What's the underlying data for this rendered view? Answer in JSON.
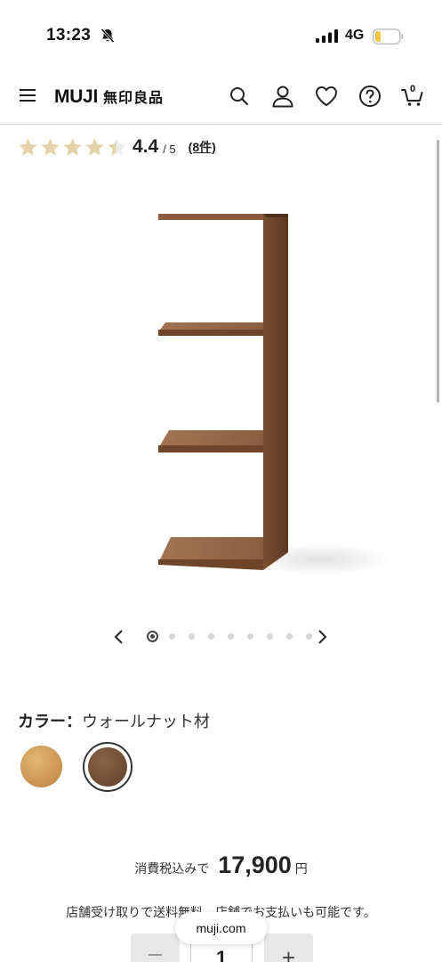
{
  "status_bar": {
    "time": "13:23",
    "network": "4G",
    "icons": [
      "bell-slash-icon",
      "cellular-signal-icon",
      "battery-low-icon"
    ],
    "battery_color": "#f5c542"
  },
  "header": {
    "logo_text": "MUJI",
    "logo_jp": "無印良品",
    "cart_count": "0",
    "icons": [
      "menu-icon",
      "search-icon",
      "user-icon",
      "heart-icon",
      "help-icon",
      "cart-icon"
    ]
  },
  "rating": {
    "score": "4.4",
    "max": "/ 5",
    "count": "(8件)",
    "stars_value": 4.4,
    "star_color": "#e2d3a8"
  },
  "carousel": {
    "total": 9,
    "active_index": 0
  },
  "color": {
    "label": "カラー：",
    "selected": "ウォールナット材",
    "swatches": [
      {
        "name": "oak",
        "color": "#d7a461",
        "selected": false
      },
      {
        "name": "walnut",
        "color": "#6f4c35",
        "selected": true
      }
    ]
  },
  "price": {
    "prefix": "消費税込みで",
    "value": "17,900",
    "unit": "円"
  },
  "shipping_note": "店舗受け取りで送料無料。店舗でお支払いも可能です。",
  "quantity": {
    "value": "1",
    "minus": "−",
    "plus": "+"
  },
  "url_bar": {
    "domain": "muji.com"
  }
}
